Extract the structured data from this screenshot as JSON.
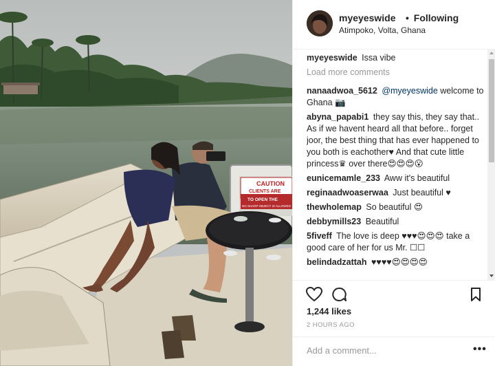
{
  "post": {
    "username": "myeyeswide",
    "separator": "•",
    "follow_status": "Following",
    "location": "Atimpoko, Volta, Ghana",
    "image_alt_subject": "woman reclining on boat with man photographing river",
    "boat_sign": {
      "line1": "CAUTION",
      "line2": "CLIENTS ARE",
      "line3": "TO OPEN THE",
      "line4": "NO SHARP OBJECT IS ALLOWED"
    }
  },
  "caption": {
    "username": "myeyeswide",
    "text": "Issa vibe"
  },
  "load_more_label": "Load more comments",
  "comments": [
    {
      "username": "nanaadwoa_5612",
      "mention": "@myeyeswide",
      "text": "welcome to Ghana 📷"
    },
    {
      "username": "abyna_papabi1",
      "mention": "",
      "text": "they say this, they say that.. As if we havent heard all that before.. forget joor, the best thing that has ever happened to you both is eachother♥ And that cute little princess♛ over there😍😍😍😮"
    },
    {
      "username": "eunicemamle_233",
      "mention": "",
      "text": "Aww it's beautiful"
    },
    {
      "username": "reginaadwoaserwaa",
      "mention": "",
      "text": "Just beautiful ♥"
    },
    {
      "username": "thewholemap",
      "mention": "",
      "text": "So beautiful 😍"
    },
    {
      "username": "debbymills23",
      "mention": "",
      "text": "Beautiful"
    },
    {
      "username": "5fiveff",
      "mention": "",
      "text": "The love is deep ♥♥♥😍😍😍 take a good care of her for us Mr. ☐☐"
    },
    {
      "username": "belindadzattah",
      "mention": "",
      "text": "♥♥♥♥😍😍😍😍"
    }
  ],
  "actions": {
    "like_icon": "heart-outline-icon",
    "comment_icon": "speech-bubble-icon",
    "save_icon": "bookmark-icon"
  },
  "likes_label": "1,244 likes",
  "timestamp": "2 HOURS AGO",
  "add_comment_placeholder": "Add a comment...",
  "more_options": "•••",
  "colors": {
    "link": "#003569",
    "muted": "#999999",
    "text": "#262626",
    "border": "#efefef"
  }
}
